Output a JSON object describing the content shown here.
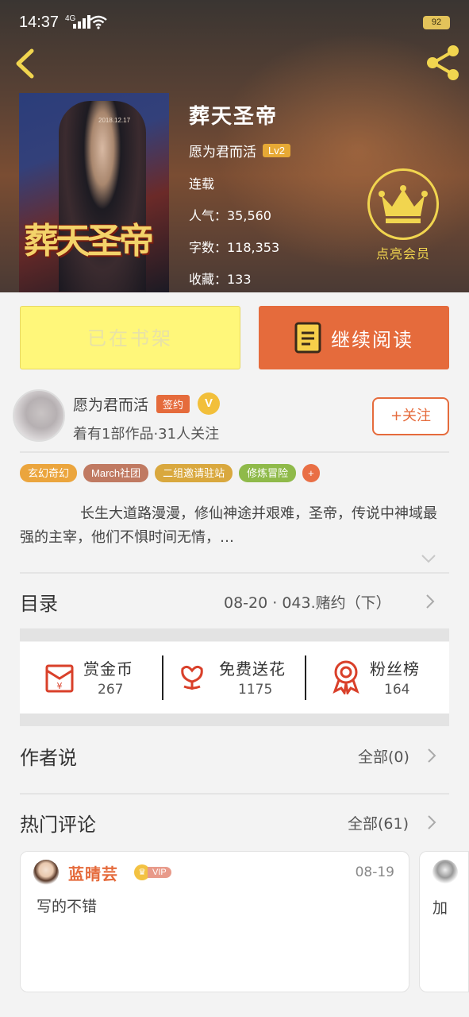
{
  "status_bar": {
    "time": "14:37",
    "network": "4G",
    "battery": "92"
  },
  "book": {
    "title": "葬天圣帝",
    "cover_title": "葬天圣帝",
    "cover_date": "2018.12.17",
    "author": "愿为君而活",
    "author_level": "Lv2",
    "state": "连载",
    "popularity": "人气：35,560",
    "words": "字数：118,353",
    "favorites": "收藏：133"
  },
  "vip_prompt": {
    "label": "点亮会员",
    "icon": "crown-icon"
  },
  "actions": {
    "shelf_label": "已在书架",
    "read_label": "继续阅读"
  },
  "author_card": {
    "name": "愿为君而活",
    "signed_badge": "签约",
    "verified_badge": "V",
    "stats": "着有1部作品·31人关注",
    "follow_label": "+关注"
  },
  "tags": [
    {
      "label": "玄幻奇幻",
      "color": "#eba53d"
    },
    {
      "label": "March社团",
      "color": "#c07a62"
    },
    {
      "label": "二组邀请驻站",
      "color": "#d9a83e"
    },
    {
      "label": "修炼冒险",
      "color": "#8fba4a"
    },
    {
      "label": "+",
      "color": "#e96f45"
    }
  ],
  "synopsis": "长生大道路漫漫，修仙神途并艰难，圣帝，传说中神域最强的主宰，他们不惧时间无情，…",
  "catalog": {
    "label": "目录",
    "latest": "08-20 · 043.赌约（下）"
  },
  "stats": [
    {
      "label": "赏金币",
      "value": "267",
      "icon": "red-envelope-icon"
    },
    {
      "label": "免费送花",
      "value": "1175",
      "icon": "flower-icon"
    },
    {
      "label": "粉丝榜",
      "value": "164",
      "icon": "medal-icon"
    }
  ],
  "author_says": {
    "label": "作者说",
    "more": "全部(0)"
  },
  "hot_comments": {
    "label": "热门评论",
    "more": "全部(61)",
    "items": [
      {
        "user": "蓝晴芸",
        "badge": "VIP",
        "date": "08-19",
        "text": "写的不错"
      },
      {
        "text": "加"
      }
    ]
  }
}
